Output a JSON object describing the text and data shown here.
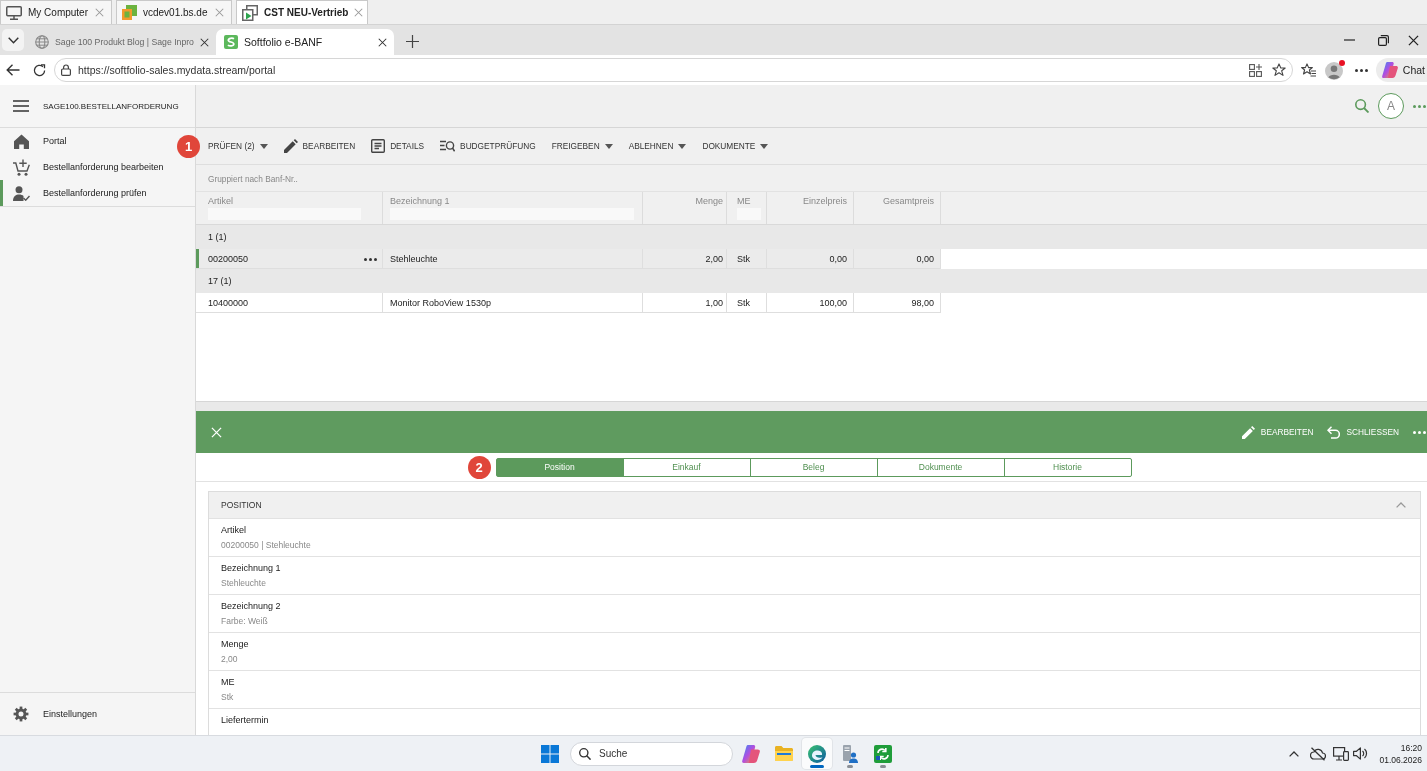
{
  "rdp_tabs": [
    {
      "label": "My Computer",
      "selected": false
    },
    {
      "label": "vcdev01.bs.de",
      "selected": false
    },
    {
      "label": "CST NEU-Vertrieb",
      "selected": true
    }
  ],
  "browser": {
    "tabs": [
      {
        "label": "Sage 100 Produkt Blog | Sage Inpro",
        "selected": false
      },
      {
        "label": "Softfolio e-BANF",
        "selected": true
      }
    ],
    "url": "https://softfolio-sales.mydata.stream/portal",
    "chat": "Chat"
  },
  "sidebar": {
    "title": "SAGE100.BESTELLANFORDERUNG",
    "items": [
      {
        "label": "Portal",
        "selected": false
      },
      {
        "label": "Bestellanforderung bearbeiten",
        "selected": false
      },
      {
        "label": "Bestellanforderung prüfen",
        "selected": true
      }
    ],
    "settings": "Einstellungen"
  },
  "header": {
    "avatar": "A"
  },
  "toolbar": {
    "marker": "1",
    "actions": [
      {
        "label": "PRÜFEN (2)",
        "kind": "menu"
      },
      {
        "label": "BEARBEITEN",
        "kind": "edit"
      },
      {
        "label": "DETAILS",
        "kind": "details"
      },
      {
        "label": "BUDGETPRÜFUNG",
        "kind": "budget"
      },
      {
        "label": "FREIGEBEN",
        "kind": "menu"
      },
      {
        "label": "ABLEHNEN",
        "kind": "menu"
      },
      {
        "label": "DOKUMENTE",
        "kind": "menu"
      }
    ]
  },
  "grid": {
    "group_hint": "Gruppiert nach Banf-Nr..",
    "columns": [
      {
        "label": "Artikel",
        "filter": true
      },
      {
        "label": "Bezeichnung 1",
        "filter": true
      },
      {
        "label": "Menge",
        "filter": false
      },
      {
        "label": "ME",
        "filter": true
      },
      {
        "label": "Einzelpreis",
        "filter": false
      },
      {
        "label": "Gesamtpreis",
        "filter": false
      }
    ],
    "groups": [
      {
        "label": "1 (1)",
        "rows": [
          {
            "selected": true,
            "cells": [
              "00200050",
              "Stehleuchte",
              "2,00",
              "Stk",
              "0,00",
              "0,00"
            ]
          }
        ]
      },
      {
        "label": "17 (1)",
        "rows": [
          {
            "selected": false,
            "cells": [
              "10400000",
              "Monitor RoboView 1530p",
              "1,00",
              "Stk",
              "100,00",
              "98,00"
            ]
          }
        ]
      }
    ]
  },
  "detail": {
    "actions": [
      {
        "label": "BEARBEITEN",
        "kind": "edit"
      },
      {
        "label": "SCHLIESSEN",
        "kind": "close"
      }
    ],
    "marker": "2",
    "tabs": [
      {
        "label": "Position",
        "selected": true
      },
      {
        "label": "Einkauf",
        "selected": false
      },
      {
        "label": "Beleg",
        "selected": false
      },
      {
        "label": "Dokumente",
        "selected": false
      },
      {
        "label": "Historie",
        "selected": false
      }
    ],
    "section": {
      "title": "POSITION",
      "expanded": true,
      "fields": [
        {
          "label": "Artikel",
          "value": "00200050 | Stehleuchte"
        },
        {
          "label": "Bezeichnung 1",
          "value": "Stehleuchte"
        },
        {
          "label": "Bezeichnung 2",
          "value": "Farbe: Weiß"
        },
        {
          "label": "Menge",
          "value": "2,00"
        },
        {
          "label": "ME",
          "value": "Stk"
        },
        {
          "label": "Liefertermin"
        }
      ]
    }
  },
  "taskbar": {
    "search": {
      "placeholder": "Suche"
    },
    "apps": [
      {
        "running": false,
        "selected": false
      },
      {
        "running": false,
        "selected": false
      },
      {
        "running": true,
        "selected": true
      },
      {
        "running": true,
        "selected": false
      },
      {
        "running": true,
        "selected": false
      }
    ],
    "time": "16:20",
    "date": "01.06.2026"
  }
}
